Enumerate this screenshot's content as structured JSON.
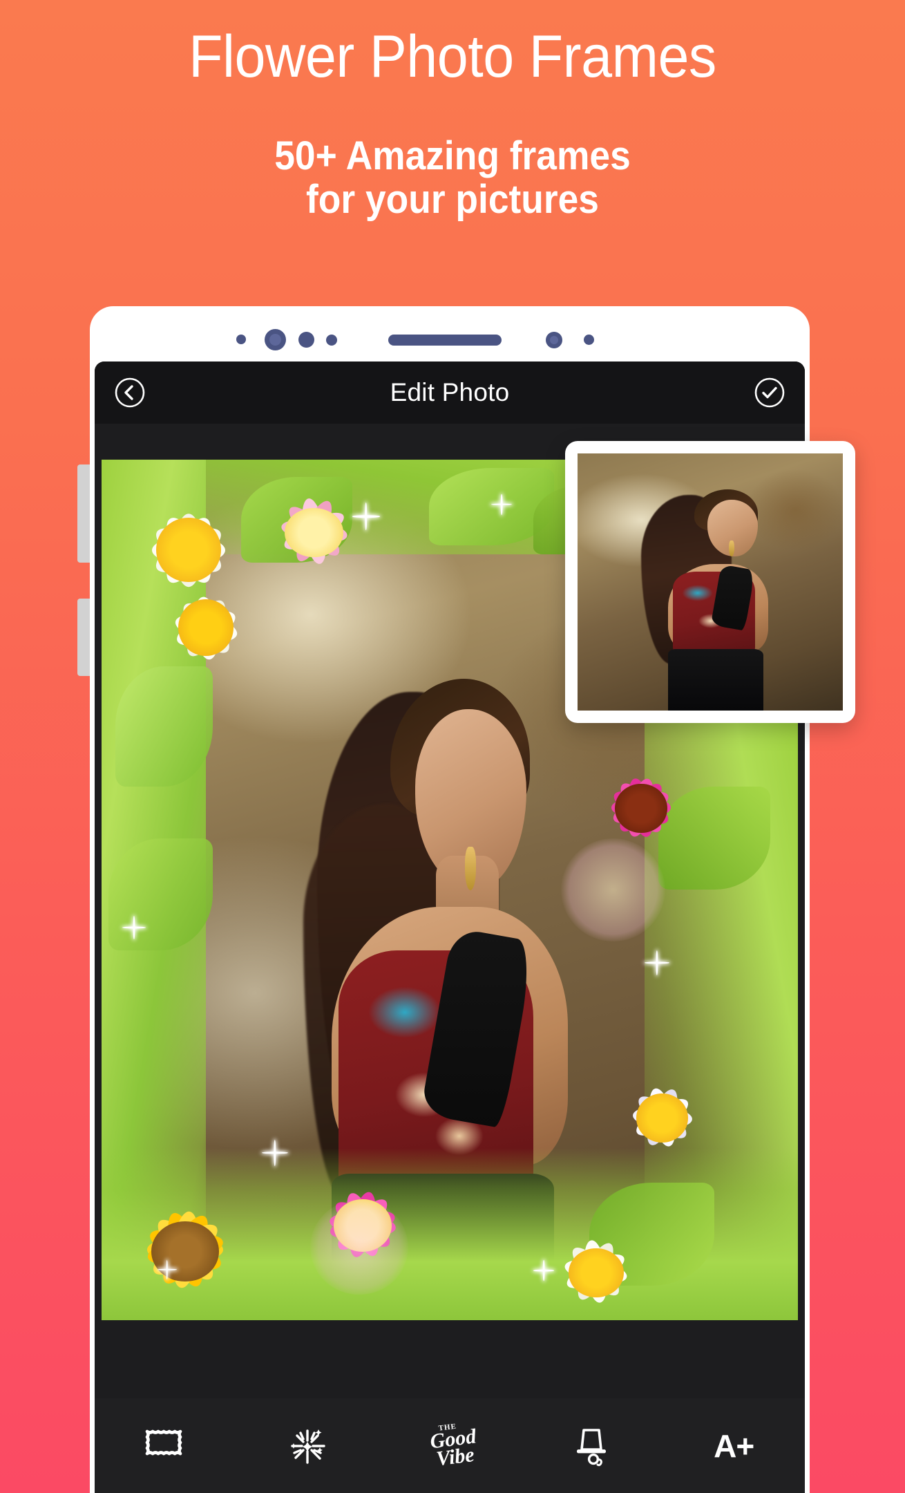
{
  "promo": {
    "headline": "Flower Photo Frames",
    "subhead_line1": "50+ Amazing frames",
    "subhead_line2": "for your pictures",
    "background_top_color": "#FA7A4F",
    "background_bottom_color": "#FB4A64",
    "text_color": "#FFFFFF"
  },
  "device": {
    "body_color": "#FFFFFF",
    "bezel_dot_color": "#4A5483",
    "side_button_color": "#D2D2D2",
    "bezel_elements": [
      {
        "name": "sensor-dot-small",
        "size": 14
      },
      {
        "name": "front-camera",
        "size": 30
      },
      {
        "name": "sensor-dot-medium",
        "size": 22
      },
      {
        "name": "sensor-dot-small-2",
        "size": 16
      },
      {
        "name": "earpiece-speaker",
        "size": 0
      },
      {
        "name": "sensor-dot-right",
        "size": 22
      },
      {
        "name": "sensor-dot-right-small",
        "size": 14
      }
    ]
  },
  "app": {
    "appbar": {
      "title": "Edit Photo",
      "back_icon": "chevron-left-circle-icon",
      "done_icon": "check-circle-icon",
      "background": "#141416",
      "text_color": "#FFFFFF"
    },
    "canvas": {
      "background": "#1D1D1F",
      "frame_name": "flower-frame",
      "frame_description": "Green leaf border with white daisies, pink daisies, magenta gerberas and a yellow sunflower"
    },
    "thumbnail_card": {
      "name": "source-photo-thumbnail",
      "card_background": "#FFFFFF"
    },
    "toolbar": {
      "background": "#202022",
      "items": [
        {
          "id": "frame",
          "icon": "picture-frame-icon",
          "label": ""
        },
        {
          "id": "effects",
          "icon": "sparkle-magic-icon",
          "label": ""
        },
        {
          "id": "stickers",
          "icon": "good-vibe-sticker-icon",
          "label": "Good Vibe",
          "label_small": "THE"
        },
        {
          "id": "props",
          "icon": "top-hat-monocle-icon",
          "label": ""
        },
        {
          "id": "text",
          "icon": "text-add-icon",
          "label": "A+"
        }
      ]
    }
  }
}
